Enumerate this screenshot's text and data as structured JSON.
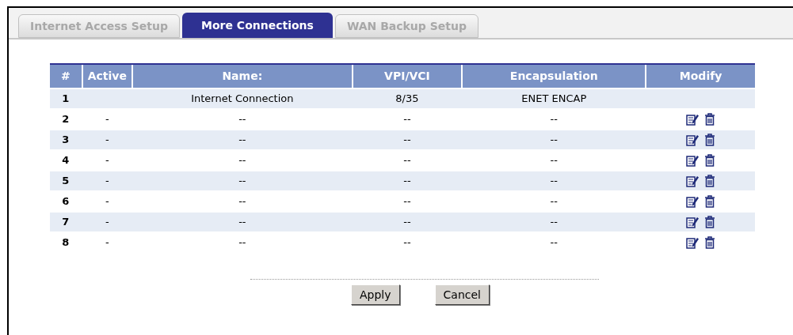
{
  "tabs": [
    {
      "label": "Internet Access Setup",
      "selected": false
    },
    {
      "label": "More Connections",
      "selected": true
    },
    {
      "label": "WAN Backup Setup",
      "selected": false
    }
  ],
  "table": {
    "columns": [
      "#",
      "Active",
      "Name:",
      "VPI/VCI",
      "Encapsulation",
      "Modify"
    ],
    "rows": [
      {
        "cells": [
          "1",
          "",
          "Internet Connection",
          "8/35",
          "ENET ENCAP"
        ],
        "editable": false
      },
      {
        "cells": [
          "2",
          "-",
          "--",
          "--",
          "--"
        ],
        "editable": true
      },
      {
        "cells": [
          "3",
          "-",
          "--",
          "--",
          "--"
        ],
        "editable": true
      },
      {
        "cells": [
          "4",
          "-",
          "--",
          "--",
          "--"
        ],
        "editable": true
      },
      {
        "cells": [
          "5",
          "-",
          "--",
          "--",
          "--"
        ],
        "editable": true
      },
      {
        "cells": [
          "6",
          "-",
          "--",
          "--",
          "--"
        ],
        "editable": true
      },
      {
        "cells": [
          "7",
          "-",
          "--",
          "--",
          "--"
        ],
        "editable": true
      },
      {
        "cells": [
          "8",
          "-",
          "--",
          "--",
          "--"
        ],
        "editable": true
      }
    ]
  },
  "buttons": [
    "Apply",
    "Cancel"
  ]
}
